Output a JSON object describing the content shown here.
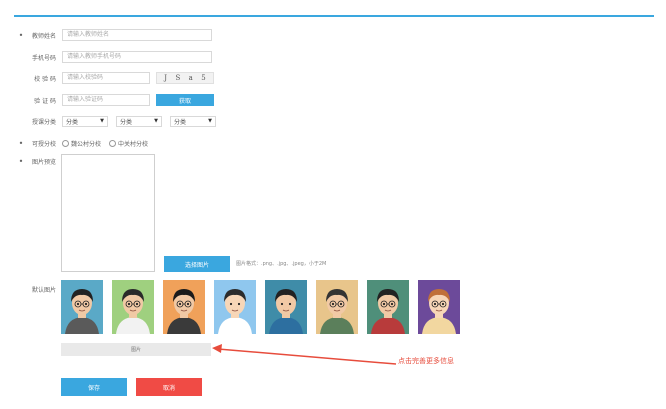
{
  "form": {
    "teacher_name": {
      "required": "•",
      "label": "教师姓名",
      "placeholder": "请输入教师姓名"
    },
    "phone": {
      "label": "手机号码",
      "placeholder": "请输入教师手机号码"
    },
    "captcha": {
      "label": "校 验 码",
      "placeholder": "请输入校验码",
      "code_chars": [
        "J",
        "S",
        "a",
        "5"
      ]
    },
    "sms_code": {
      "label": "验 证 码",
      "placeholder": "请输入验证码",
      "button": "获取"
    },
    "category": {
      "label": "授课分类",
      "selects": [
        "分类",
        "分类",
        "分类"
      ],
      "arrow": "▼"
    },
    "campus": {
      "required": "•",
      "label": "可授分校",
      "options": [
        "魏公村分校",
        "中关村分校"
      ]
    },
    "preview": {
      "required": "•",
      "label": "图片预览"
    },
    "upload": {
      "button": "选择图片",
      "format_hint": "图片格式：.png、.jpg、.jpeg，小于2M"
    },
    "default_images": {
      "label": "默认图片"
    },
    "more": {
      "label": "图片"
    },
    "annotation": "点击完善更多信息",
    "save": "保存",
    "cancel": "取消"
  },
  "colors": {
    "accent": "#3aa7df",
    "danger": "#f04b45",
    "annotation": "#e74c3c"
  },
  "avatars": [
    {
      "name": "avatar-1",
      "bg": "#5aa9c7",
      "skin": "#f1c9a5",
      "hair": "#222222",
      "shirt": "#5a5a5a",
      "glasses": true
    },
    {
      "name": "avatar-2",
      "bg": "#9fd07f",
      "skin": "#f1c9a5",
      "hair": "#2a2a2a",
      "shirt": "#f2f2f2",
      "glasses": true
    },
    {
      "name": "avatar-3",
      "bg": "#f0a15a",
      "skin": "#f1c9a5",
      "hair": "#1a1a1a",
      "shirt": "#3a3a3a",
      "glasses": true
    },
    {
      "name": "avatar-4",
      "bg": "#8fc7ee",
      "skin": "#f7d6b7",
      "hair": "#2b2b2b",
      "shirt": "#ffffff",
      "glasses": false
    },
    {
      "name": "avatar-5",
      "bg": "#3f8ca8",
      "skin": "#f1c9a5",
      "hair": "#222222",
      "shirt": "#2d6fa0",
      "glasses": false
    },
    {
      "name": "avatar-6",
      "bg": "#e8c58b",
      "skin": "#f1c9a5",
      "hair": "#333333",
      "shirt": "#5b7f5b",
      "glasses": true
    },
    {
      "name": "avatar-7",
      "bg": "#4f8f7a",
      "skin": "#f1c9a5",
      "hair": "#222222",
      "shirt": "#b83b3b",
      "glasses": true
    },
    {
      "name": "avatar-8",
      "bg": "#6c4a9a",
      "skin": "#f7d6b7",
      "hair": "#c0703a",
      "shirt": "#f2d7a0",
      "glasses": true
    }
  ]
}
